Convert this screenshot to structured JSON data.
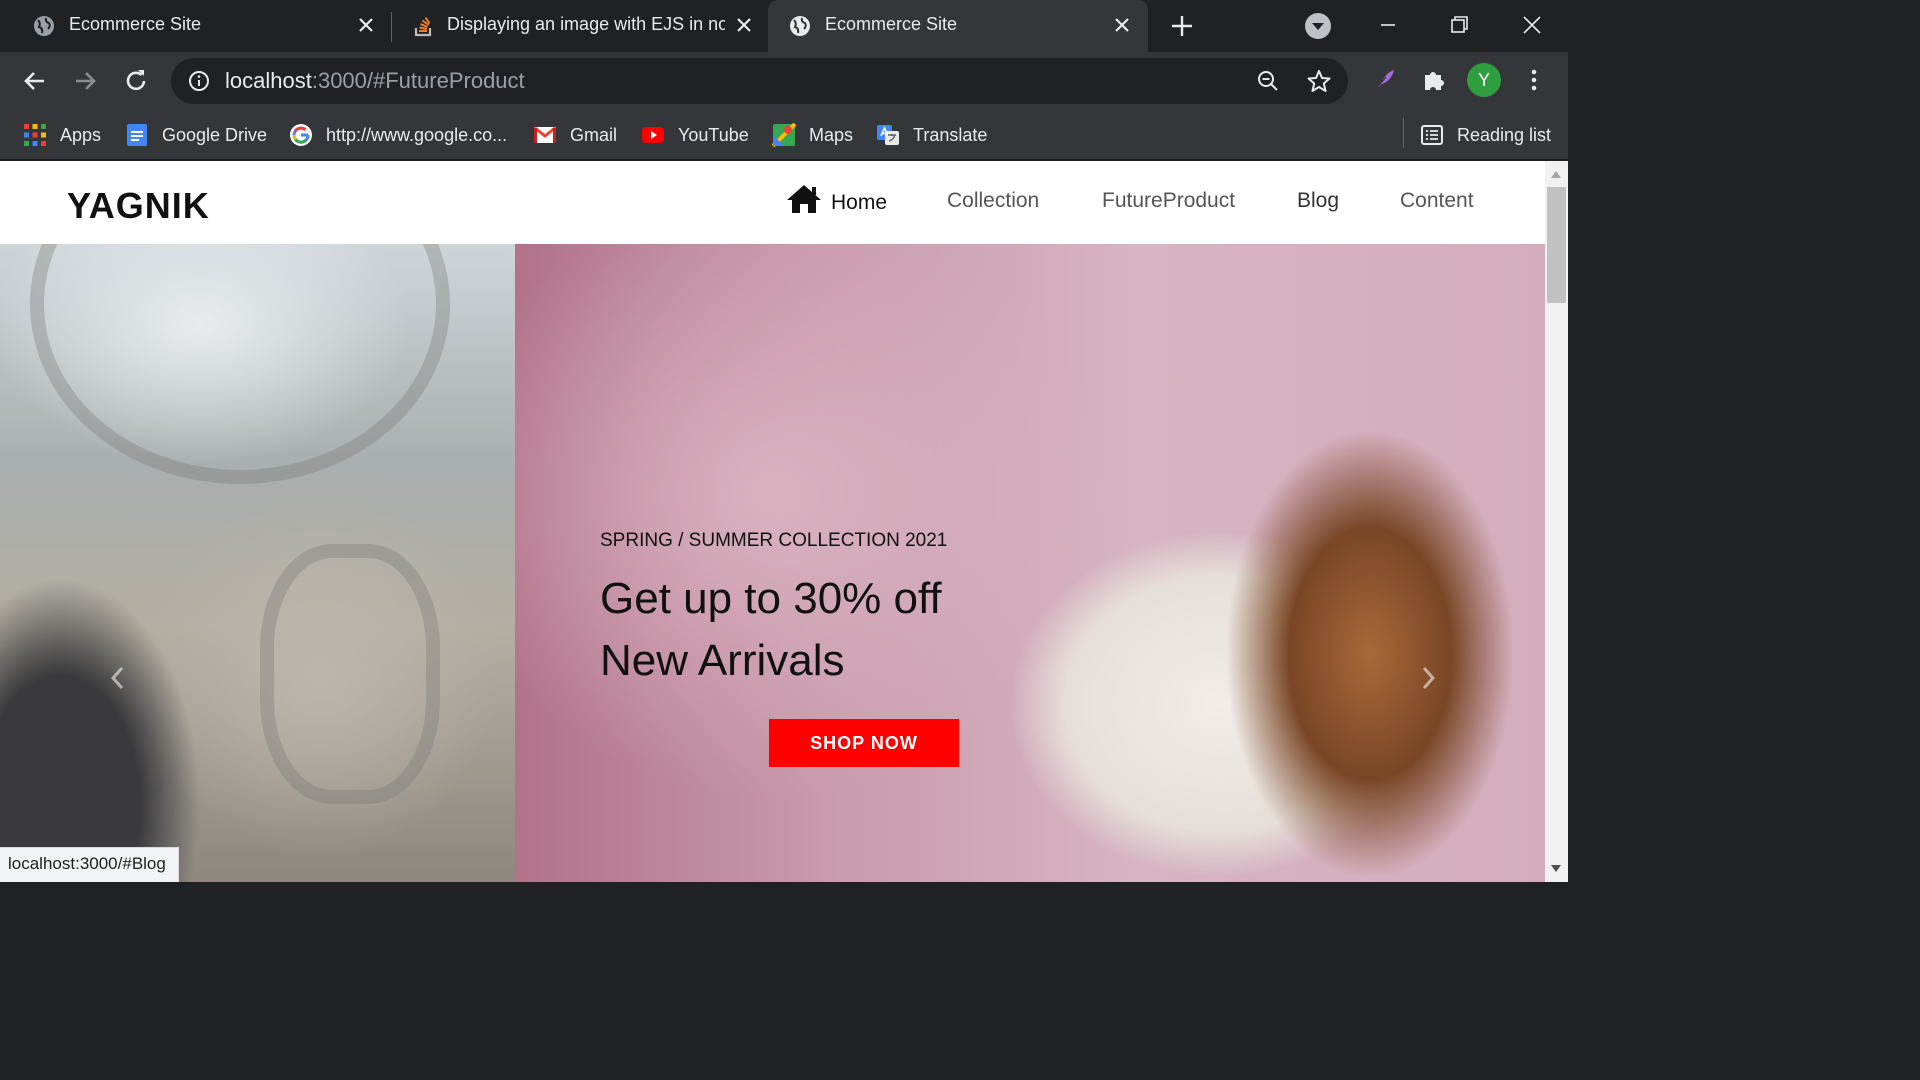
{
  "browser": {
    "tabs": [
      {
        "title": "Ecommerce Site",
        "active": false
      },
      {
        "title": "Displaying an image with EJS in nod",
        "active": false
      },
      {
        "title": "Ecommerce Site",
        "active": true
      }
    ],
    "address_bar": {
      "host": "localhost",
      "path": ":3000/#FutureProduct"
    },
    "profile_initial": "Y",
    "bookmarks": [
      {
        "label": "Apps",
        "icon": "apps-grid-icon"
      },
      {
        "label": "Google Drive",
        "icon": "google-docs-icon"
      },
      {
        "label": "http://www.google.co...",
        "icon": "google-icon"
      },
      {
        "label": "Gmail",
        "icon": "gmail-icon"
      },
      {
        "label": "YouTube",
        "icon": "youtube-icon"
      },
      {
        "label": "Maps",
        "icon": "maps-icon"
      },
      {
        "label": "Translate",
        "icon": "translate-icon"
      }
    ],
    "reading_list": "Reading list",
    "status_url": "localhost:3000/#Blog"
  },
  "site": {
    "logo": "YAGNIK",
    "nav": {
      "home": "Home",
      "collection": "Collection",
      "future_product": "FutureProduct",
      "blog": "Blog",
      "content": "Content"
    },
    "hero": {
      "subhead": "SPRING / SUMMER COLLECTION 2021",
      "headline_line1": "Get up to 30% off",
      "headline_line2": "New Arrivals",
      "cta": "SHOP NOW"
    }
  },
  "colors": {
    "accent": "#ff0000",
    "browser_dark": "#202124",
    "browser_toolbar": "#35363a",
    "avatar": "#2f9e3f"
  }
}
